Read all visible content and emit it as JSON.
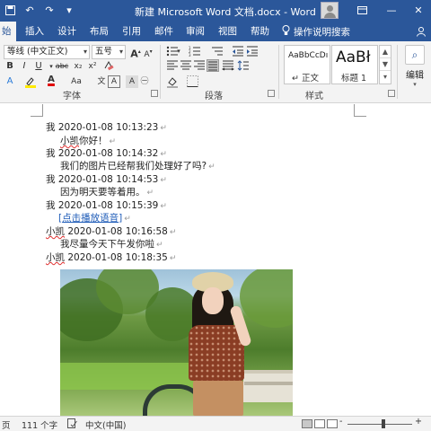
{
  "window": {
    "title": "新建 Microsoft Word 文档.docx  -  Word",
    "qat_icons": [
      "save-icon",
      "undo-icon",
      "redo-icon",
      "customize-icon"
    ],
    "win_buttons": [
      "minimize-icon",
      "restore-icon",
      "close-icon"
    ]
  },
  "menu": {
    "tabs": [
      "始",
      "插入",
      "设计",
      "布局",
      "引用",
      "邮件",
      "审阅",
      "视图",
      "帮助"
    ],
    "active_tab": "始",
    "tell_me": "操作说明搜索"
  },
  "ribbon": {
    "font": {
      "name": "等线 (中文正文)",
      "size": "五号",
      "label": "字体",
      "buttons": [
        "B",
        "I",
        "U",
        "abc",
        "x₂",
        "x²",
        "A",
        "A",
        "A",
        "Aa",
        "A",
        "A",
        "A"
      ]
    },
    "paragraph": {
      "label": "段落"
    },
    "styles": {
      "label": "样式",
      "items": [
        {
          "preview": "AaBbCcDı",
          "name": "↵ 正文"
        },
        {
          "preview": "AaBł",
          "name": "标题 1"
        }
      ]
    },
    "editing": {
      "label": "编辑"
    }
  },
  "document": {
    "lines": [
      {
        "text": "我  2020-01-08 10:13:23"
      },
      {
        "pre": "",
        "squig": "小凯",
        "post": "你好！"
      },
      {
        "text": "我  2020-01-08 10:14:32"
      },
      {
        "text": "我们的图片已经帮我们处理好了吗?"
      },
      {
        "text": "我  2020-01-08 10:14:53"
      },
      {
        "text": "因为明天要等着用。"
      },
      {
        "text": "我  2020-01-08 10:15:39"
      },
      {
        "link": "点击播放语音"
      },
      {
        "pre": "",
        "squig": "小凯",
        "post": "  2020-01-08 10:16:58"
      },
      {
        "text": "我尽量今天下午发你啦"
      },
      {
        "pre": "",
        "squig": "小凯",
        "post": "  2020-01-08 10:18:35"
      }
    ],
    "return_mark": "↵"
  },
  "status": {
    "page": "页",
    "words": "111 个字",
    "lang": "中文(中国)",
    "zoom_minus": "-",
    "zoom_plus": "+"
  },
  "colors": {
    "titlebar": "#2b579a",
    "ribbon": "#f3f3f3"
  }
}
